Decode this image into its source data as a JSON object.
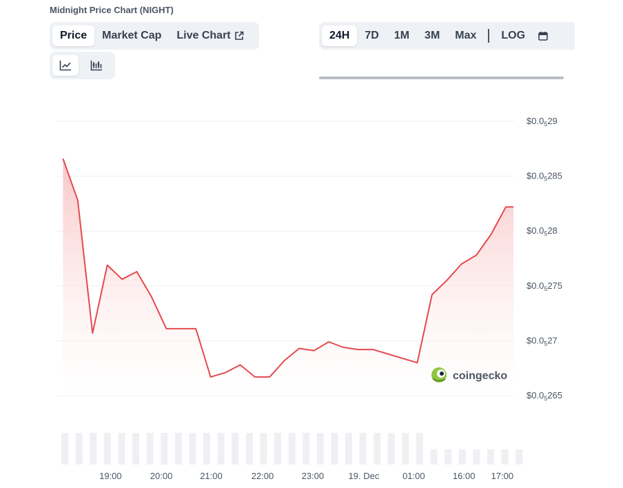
{
  "header": {
    "title": "Midnight Price Chart (NIGHT)"
  },
  "view_tabs": [
    {
      "label": "Price",
      "active": true
    },
    {
      "label": "Market Cap",
      "active": false
    },
    {
      "label": "Live Chart",
      "active": false,
      "icon": "external-link-icon"
    }
  ],
  "range_tabs": [
    {
      "label": "24H",
      "active": true
    },
    {
      "label": "7D",
      "active": false
    },
    {
      "label": "1M",
      "active": false
    },
    {
      "label": "3M",
      "active": false
    },
    {
      "label": "Max",
      "active": false
    }
  ],
  "scale_toggle": {
    "label": "LOG"
  },
  "chart_type_buttons": [
    {
      "icon": "line-chart-icon",
      "active": true
    },
    {
      "icon": "candlestick-chart-icon",
      "active": false
    }
  ],
  "calendar": {
    "icon": "calendar-icon"
  },
  "watermark": {
    "text": "coingecko",
    "icon": "coingecko-logo-icon"
  },
  "colors": {
    "line": "#e5484d",
    "fill_top": "#f9c3c3",
    "grid": "#eceef1",
    "volume": "#eef0f3",
    "accent_green": "#8dc63f"
  },
  "chart_data": {
    "type": "line",
    "title": "",
    "xlabel": "",
    "ylabel": "",
    "y_ticks": [
      {
        "prefix": "$0.0",
        "sub": "5",
        "suffix": "29",
        "value": 2.9e-06
      },
      {
        "prefix": "$0.0",
        "sub": "5",
        "suffix": "285",
        "value": 2.85e-06
      },
      {
        "prefix": "$0.0",
        "sub": "5",
        "suffix": "28",
        "value": 2.8e-06
      },
      {
        "prefix": "$0.0",
        "sub": "5",
        "suffix": "275",
        "value": 2.75e-06
      },
      {
        "prefix": "$0.0",
        "sub": "5",
        "suffix": "27",
        "value": 2.7e-06
      },
      {
        "prefix": "$0.0",
        "sub": "5",
        "suffix": "265",
        "value": 2.65e-06
      }
    ],
    "x_ticks": [
      {
        "label": "19:00",
        "hour": 1.83
      },
      {
        "label": "20:00",
        "hour": 3.55
      },
      {
        "label": "21:00",
        "hour": 5.24
      },
      {
        "label": "22:00",
        "hour": 6.98
      },
      {
        "label": "23:00",
        "hour": 8.68
      },
      {
        "label": "19. Dec",
        "hour": 10.41
      },
      {
        "label": "01:00",
        "hour": 12.1
      },
      {
        "label": "16:00",
        "hour": 13.8
      },
      {
        "label": "17:00",
        "hour": 15.1
      }
    ],
    "ylim": [
      2.655e-06,
      2.9e-06
    ],
    "xlim": [
      0,
      15.5
    ],
    "grid": true,
    "legend": "none",
    "series": [
      {
        "x": [
          0.22,
          0.72,
          1.22,
          1.72,
          2.22,
          2.72,
          3.22,
          3.72,
          4.22,
          4.72,
          5.22,
          5.72,
          6.22,
          6.72,
          7.22,
          7.72,
          8.22,
          8.72,
          9.22,
          9.72,
          10.22,
          10.72,
          11.22,
          11.72,
          12.22,
          12.72,
          13.22,
          13.72,
          14.22,
          14.72,
          15.22
        ],
        "y": [
          2.866e-06,
          2.828e-06,
          2.707e-06,
          2.769e-06,
          2.756e-06,
          2.763e-06,
          2.74e-06,
          2.711e-06,
          2.711e-06,
          2.711e-06,
          2.667e-06,
          2.671e-06,
          2.678e-06,
          2.667e-06,
          2.667e-06,
          2.682e-06,
          2.693e-06,
          2.691e-06,
          2.699e-06,
          2.694e-06,
          2.692e-06,
          2.692e-06,
          2.688e-06,
          2.684e-06,
          2.68e-06,
          2.742e-06,
          2.755e-06,
          2.77e-06,
          2.778e-06,
          2.797e-06,
          2.822e-06
        ]
      }
    ],
    "volume": [
      0.2,
      0.2,
      0.2,
      0.2,
      0.2,
      0.2,
      0.2,
      0.2,
      0.2,
      0.2,
      0.2,
      0.2,
      0.2,
      0.2,
      0.2,
      0.2,
      0.2,
      0.2,
      0.2,
      0.2,
      0.2,
      0.2,
      0.2,
      0.2,
      0.2,
      0.2,
      0.48,
      0.48,
      0.48,
      0.48,
      0.48,
      0.48,
      0.48
    ]
  }
}
